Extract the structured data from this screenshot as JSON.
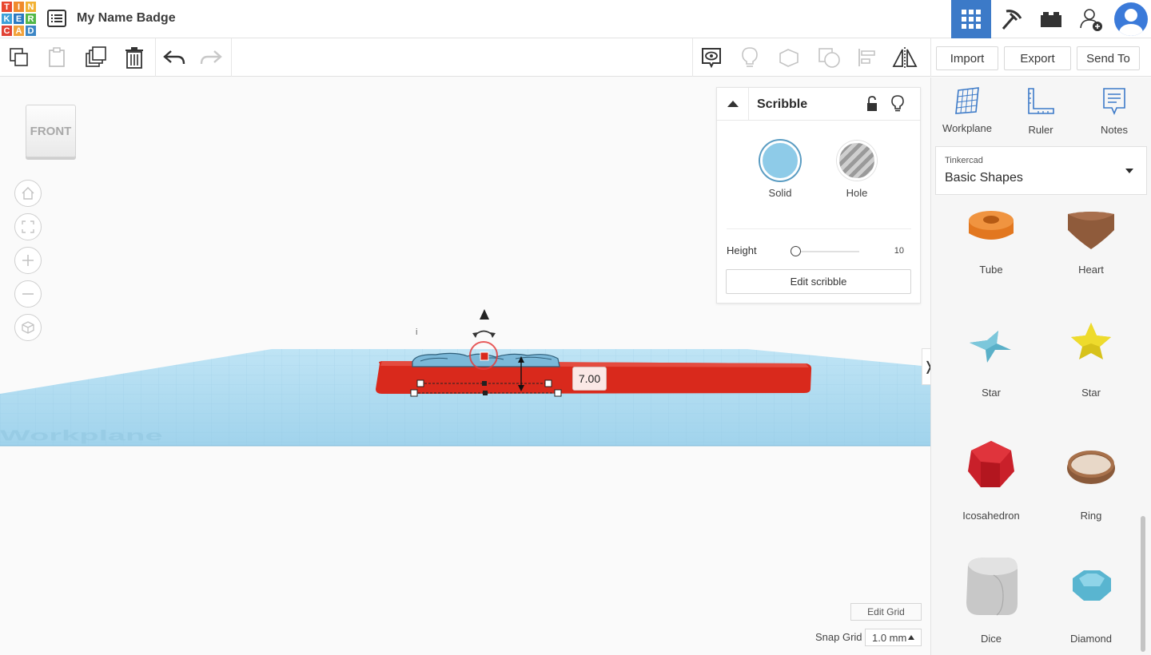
{
  "header": {
    "logo_letters": [
      "T",
      "I",
      "N",
      "K",
      "E",
      "R",
      "C",
      "A",
      "D"
    ],
    "logo_colors": [
      "#e8472f",
      "#f08a2c",
      "#f2b134",
      "#3ea0d8",
      "#2b79c2",
      "#53b748",
      "#e14335",
      "#f2a23b",
      "#3c86c5"
    ],
    "title": "My Name Badge"
  },
  "toolbar": {
    "import_label": "Import",
    "export_label": "Export",
    "sendto_label": "Send To"
  },
  "viewport": {
    "viewcube_label": "FRONT",
    "dimension_value": "7.00",
    "workplane_watermark": "Workplane"
  },
  "inspector": {
    "title": "Scribble",
    "solid_label": "Solid",
    "hole_label": "Hole",
    "height_label": "Height",
    "height_value": "10",
    "edit_button": "Edit scribble"
  },
  "grid": {
    "edit_grid_label": "Edit Grid",
    "snap_label": "Snap Grid",
    "snap_value": "1.0 mm"
  },
  "panel": {
    "tools": [
      {
        "label": "Workplane"
      },
      {
        "label": "Ruler"
      },
      {
        "label": "Notes"
      }
    ],
    "library_source": "Tinkercad",
    "library_name": "Basic Shapes",
    "shapes": [
      {
        "label": "Tube"
      },
      {
        "label": "Heart"
      },
      {
        "label": "Star"
      },
      {
        "label": "Star"
      },
      {
        "label": "Icosahedron"
      },
      {
        "label": "Ring"
      },
      {
        "label": "Dice"
      },
      {
        "label": "Diamond"
      }
    ]
  },
  "colors": {
    "accent": "#3c7ac8",
    "solid": "#8ecbe8",
    "model_red": "#d9291c",
    "workplane_blue": "#a6d8ef"
  }
}
